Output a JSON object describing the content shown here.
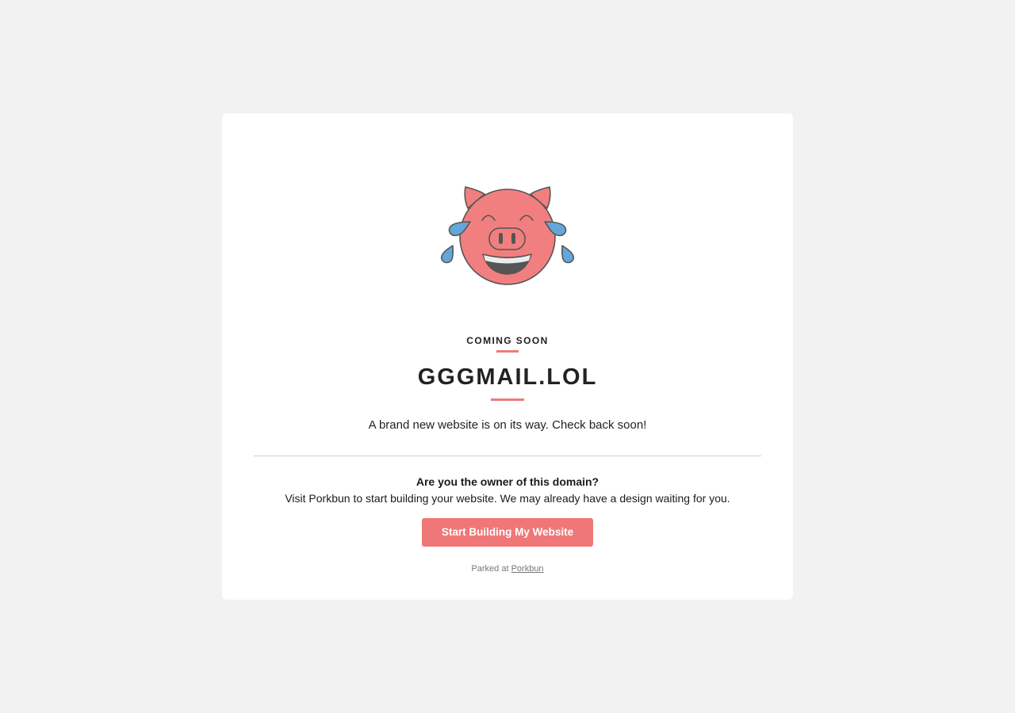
{
  "hero": {
    "icon": "laughing-pig-icon",
    "eyebrow": "COMING SOON",
    "domain": "GGGMAIL.LOL",
    "tagline": "A brand new website is on its way. Check back soon!"
  },
  "owner": {
    "question": "Are you the owner of this domain?",
    "message": "Visit Porkbun to start building your website. We may already have a design waiting for you.",
    "cta_label": "Start Building My Website"
  },
  "footer": {
    "parked_prefix": "Parked at",
    "parked_link": "Porkbun"
  },
  "colors": {
    "accent": "#ef7777",
    "background": "#f2f2f2",
    "card": "#ffffff",
    "tear": "#64a6d9",
    "outline": "#555555"
  }
}
